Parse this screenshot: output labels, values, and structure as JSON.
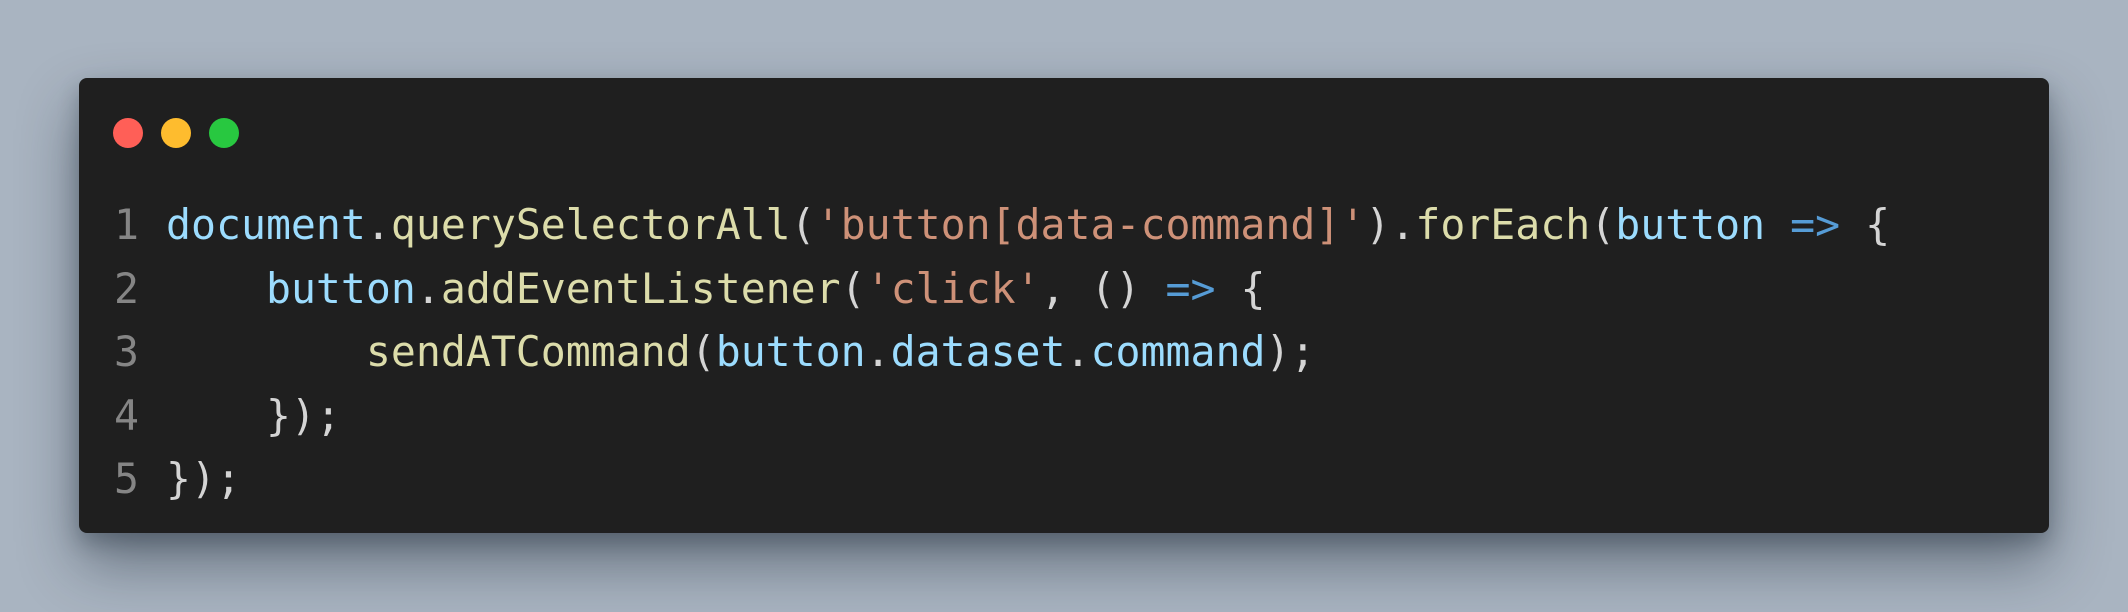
{
  "window": {
    "controls": [
      {
        "name": "close",
        "color": "#ff5f57"
      },
      {
        "name": "minimize",
        "color": "#febc2e"
      },
      {
        "name": "maximize",
        "color": "#28c840"
      }
    ]
  },
  "code": {
    "lines": [
      {
        "number": "1",
        "tokens": [
          {
            "t": "document",
            "c": "var"
          },
          {
            "t": ".",
            "c": "pun"
          },
          {
            "t": "querySelectorAll",
            "c": "fn"
          },
          {
            "t": "(",
            "c": "pun"
          },
          {
            "t": "'button[data-command]'",
            "c": "str"
          },
          {
            "t": ").",
            "c": "pun"
          },
          {
            "t": "forEach",
            "c": "fn"
          },
          {
            "t": "(",
            "c": "pun"
          },
          {
            "t": "button",
            "c": "var"
          },
          {
            "t": " ",
            "c": "pun"
          },
          {
            "t": "=>",
            "c": "kw"
          },
          {
            "t": " {",
            "c": "pun"
          }
        ]
      },
      {
        "number": "2",
        "tokens": [
          {
            "t": "    ",
            "c": "pun"
          },
          {
            "t": "button",
            "c": "var"
          },
          {
            "t": ".",
            "c": "pun"
          },
          {
            "t": "addEventListener",
            "c": "fn"
          },
          {
            "t": "(",
            "c": "pun"
          },
          {
            "t": "'click'",
            "c": "str"
          },
          {
            "t": ", () ",
            "c": "pun"
          },
          {
            "t": "=>",
            "c": "kw"
          },
          {
            "t": " {",
            "c": "pun"
          }
        ]
      },
      {
        "number": "3",
        "tokens": [
          {
            "t": "        ",
            "c": "pun"
          },
          {
            "t": "sendATCommand",
            "c": "fn"
          },
          {
            "t": "(",
            "c": "pun"
          },
          {
            "t": "button",
            "c": "var"
          },
          {
            "t": ".",
            "c": "pun"
          },
          {
            "t": "dataset",
            "c": "var"
          },
          {
            "t": ".",
            "c": "pun"
          },
          {
            "t": "command",
            "c": "var"
          },
          {
            "t": ");",
            "c": "pun"
          }
        ]
      },
      {
        "number": "4",
        "tokens": [
          {
            "t": "    });",
            "c": "pun"
          }
        ]
      },
      {
        "number": "5",
        "tokens": [
          {
            "t": "});",
            "c": "pun"
          }
        ]
      }
    ]
  }
}
